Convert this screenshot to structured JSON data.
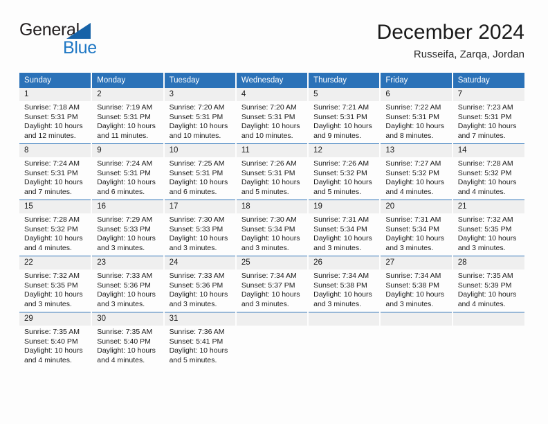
{
  "brand": {
    "name_top": "General",
    "name_bottom": "Blue",
    "triangle_color": "#1763a8",
    "blue_color": "#1e77c4"
  },
  "header": {
    "title": "December 2024",
    "subtitle": "Russeifa, Zarqa, Jordan"
  },
  "theme": {
    "header_bg": "#2b72b8",
    "daynum_bg": "#efefef",
    "page_bg": "#fdfdfd"
  },
  "calendar": {
    "weekday_headers": [
      "Sunday",
      "Monday",
      "Tuesday",
      "Wednesday",
      "Thursday",
      "Friday",
      "Saturday"
    ],
    "weeks": [
      [
        {
          "day": "1",
          "sunrise": "Sunrise: 7:18 AM",
          "sunset": "Sunset: 5:31 PM",
          "daylight": "Daylight: 10 hours and 12 minutes."
        },
        {
          "day": "2",
          "sunrise": "Sunrise: 7:19 AM",
          "sunset": "Sunset: 5:31 PM",
          "daylight": "Daylight: 10 hours and 11 minutes."
        },
        {
          "day": "3",
          "sunrise": "Sunrise: 7:20 AM",
          "sunset": "Sunset: 5:31 PM",
          "daylight": "Daylight: 10 hours and 10 minutes."
        },
        {
          "day": "4",
          "sunrise": "Sunrise: 7:20 AM",
          "sunset": "Sunset: 5:31 PM",
          "daylight": "Daylight: 10 hours and 10 minutes."
        },
        {
          "day": "5",
          "sunrise": "Sunrise: 7:21 AM",
          "sunset": "Sunset: 5:31 PM",
          "daylight": "Daylight: 10 hours and 9 minutes."
        },
        {
          "day": "6",
          "sunrise": "Sunrise: 7:22 AM",
          "sunset": "Sunset: 5:31 PM",
          "daylight": "Daylight: 10 hours and 8 minutes."
        },
        {
          "day": "7",
          "sunrise": "Sunrise: 7:23 AM",
          "sunset": "Sunset: 5:31 PM",
          "daylight": "Daylight: 10 hours and 7 minutes."
        }
      ],
      [
        {
          "day": "8",
          "sunrise": "Sunrise: 7:24 AM",
          "sunset": "Sunset: 5:31 PM",
          "daylight": "Daylight: 10 hours and 7 minutes."
        },
        {
          "day": "9",
          "sunrise": "Sunrise: 7:24 AM",
          "sunset": "Sunset: 5:31 PM",
          "daylight": "Daylight: 10 hours and 6 minutes."
        },
        {
          "day": "10",
          "sunrise": "Sunrise: 7:25 AM",
          "sunset": "Sunset: 5:31 PM",
          "daylight": "Daylight: 10 hours and 6 minutes."
        },
        {
          "day": "11",
          "sunrise": "Sunrise: 7:26 AM",
          "sunset": "Sunset: 5:31 PM",
          "daylight": "Daylight: 10 hours and 5 minutes."
        },
        {
          "day": "12",
          "sunrise": "Sunrise: 7:26 AM",
          "sunset": "Sunset: 5:32 PM",
          "daylight": "Daylight: 10 hours and 5 minutes."
        },
        {
          "day": "13",
          "sunrise": "Sunrise: 7:27 AM",
          "sunset": "Sunset: 5:32 PM",
          "daylight": "Daylight: 10 hours and 4 minutes."
        },
        {
          "day": "14",
          "sunrise": "Sunrise: 7:28 AM",
          "sunset": "Sunset: 5:32 PM",
          "daylight": "Daylight: 10 hours and 4 minutes."
        }
      ],
      [
        {
          "day": "15",
          "sunrise": "Sunrise: 7:28 AM",
          "sunset": "Sunset: 5:32 PM",
          "daylight": "Daylight: 10 hours and 4 minutes."
        },
        {
          "day": "16",
          "sunrise": "Sunrise: 7:29 AM",
          "sunset": "Sunset: 5:33 PM",
          "daylight": "Daylight: 10 hours and 3 minutes."
        },
        {
          "day": "17",
          "sunrise": "Sunrise: 7:30 AM",
          "sunset": "Sunset: 5:33 PM",
          "daylight": "Daylight: 10 hours and 3 minutes."
        },
        {
          "day": "18",
          "sunrise": "Sunrise: 7:30 AM",
          "sunset": "Sunset: 5:34 PM",
          "daylight": "Daylight: 10 hours and 3 minutes."
        },
        {
          "day": "19",
          "sunrise": "Sunrise: 7:31 AM",
          "sunset": "Sunset: 5:34 PM",
          "daylight": "Daylight: 10 hours and 3 minutes."
        },
        {
          "day": "20",
          "sunrise": "Sunrise: 7:31 AM",
          "sunset": "Sunset: 5:34 PM",
          "daylight": "Daylight: 10 hours and 3 minutes."
        },
        {
          "day": "21",
          "sunrise": "Sunrise: 7:32 AM",
          "sunset": "Sunset: 5:35 PM",
          "daylight": "Daylight: 10 hours and 3 minutes."
        }
      ],
      [
        {
          "day": "22",
          "sunrise": "Sunrise: 7:32 AM",
          "sunset": "Sunset: 5:35 PM",
          "daylight": "Daylight: 10 hours and 3 minutes."
        },
        {
          "day": "23",
          "sunrise": "Sunrise: 7:33 AM",
          "sunset": "Sunset: 5:36 PM",
          "daylight": "Daylight: 10 hours and 3 minutes."
        },
        {
          "day": "24",
          "sunrise": "Sunrise: 7:33 AM",
          "sunset": "Sunset: 5:36 PM",
          "daylight": "Daylight: 10 hours and 3 minutes."
        },
        {
          "day": "25",
          "sunrise": "Sunrise: 7:34 AM",
          "sunset": "Sunset: 5:37 PM",
          "daylight": "Daylight: 10 hours and 3 minutes."
        },
        {
          "day": "26",
          "sunrise": "Sunrise: 7:34 AM",
          "sunset": "Sunset: 5:38 PM",
          "daylight": "Daylight: 10 hours and 3 minutes."
        },
        {
          "day": "27",
          "sunrise": "Sunrise: 7:34 AM",
          "sunset": "Sunset: 5:38 PM",
          "daylight": "Daylight: 10 hours and 3 minutes."
        },
        {
          "day": "28",
          "sunrise": "Sunrise: 7:35 AM",
          "sunset": "Sunset: 5:39 PM",
          "daylight": "Daylight: 10 hours and 4 minutes."
        }
      ],
      [
        {
          "day": "29",
          "sunrise": "Sunrise: 7:35 AM",
          "sunset": "Sunset: 5:40 PM",
          "daylight": "Daylight: 10 hours and 4 minutes."
        },
        {
          "day": "30",
          "sunrise": "Sunrise: 7:35 AM",
          "sunset": "Sunset: 5:40 PM",
          "daylight": "Daylight: 10 hours and 4 minutes."
        },
        {
          "day": "31",
          "sunrise": "Sunrise: 7:36 AM",
          "sunset": "Sunset: 5:41 PM",
          "daylight": "Daylight: 10 hours and 5 minutes."
        },
        {
          "day": "",
          "sunrise": "",
          "sunset": "",
          "daylight": ""
        },
        {
          "day": "",
          "sunrise": "",
          "sunset": "",
          "daylight": ""
        },
        {
          "day": "",
          "sunrise": "",
          "sunset": "",
          "daylight": ""
        },
        {
          "day": "",
          "sunrise": "",
          "sunset": "",
          "daylight": ""
        }
      ]
    ]
  }
}
